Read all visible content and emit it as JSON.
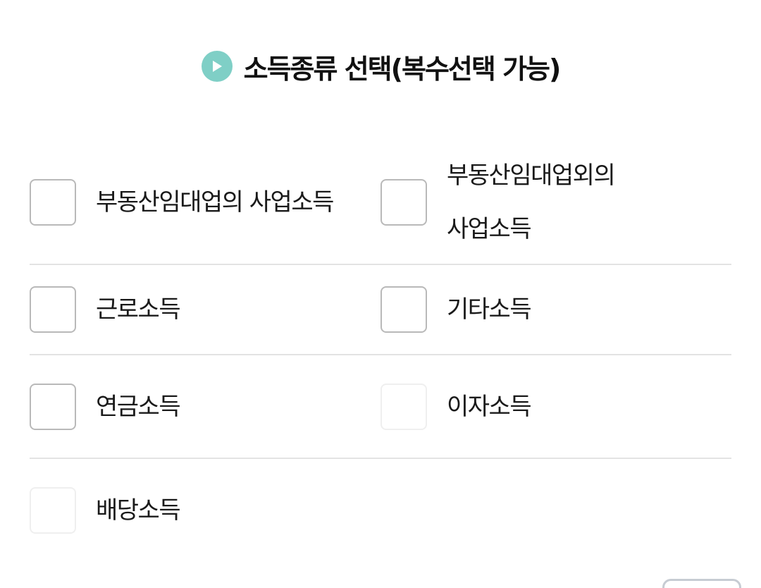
{
  "header": {
    "icon": "play-circle-icon",
    "title": "소득종류 선택(복수선택 가능)",
    "icon_color": "#7fcfc6"
  },
  "options": [
    {
      "label": "부동산임대업의 사업소득",
      "checked": false
    },
    {
      "label_line1": "부동산임대업외의",
      "label_line2": "사업소득",
      "checked": false
    },
    {
      "label": "근로소득",
      "checked": false
    },
    {
      "label": "기타소득",
      "checked": false
    },
    {
      "label": "연금소득",
      "checked": false
    },
    {
      "label": "이자소득",
      "checked": false
    },
    {
      "label": "배당소득",
      "checked": false
    }
  ]
}
